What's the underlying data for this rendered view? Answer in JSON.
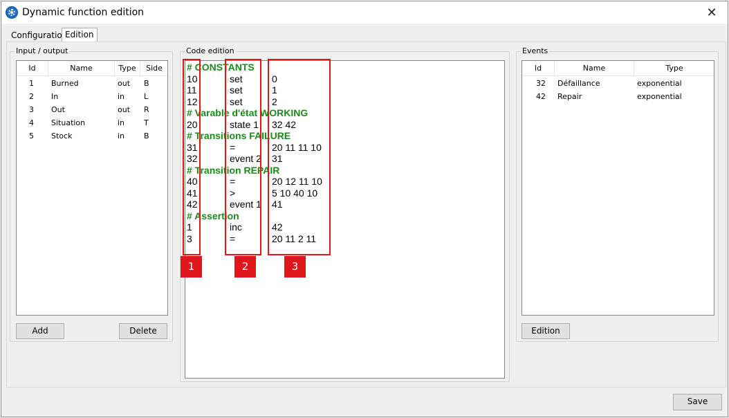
{
  "window": {
    "title": "Dynamic function edition"
  },
  "tabs": [
    {
      "label": "Configuration",
      "selected": false
    },
    {
      "label": "Edition",
      "selected": true
    }
  ],
  "io_panel": {
    "title": "Input / output",
    "columns": [
      "Id",
      "Name",
      "Type",
      "Side"
    ],
    "rows": [
      {
        "id": "1",
        "name": "Burned",
        "type": "out",
        "side": "B"
      },
      {
        "id": "2",
        "name": "In",
        "type": "in",
        "side": "L"
      },
      {
        "id": "3",
        "name": "Out",
        "type": "out",
        "side": "R"
      },
      {
        "id": "4",
        "name": "Situation",
        "type": "in",
        "side": "T"
      },
      {
        "id": "5",
        "name": "Stock",
        "type": "in",
        "side": "B"
      }
    ],
    "add_label": "Add",
    "delete_label": "Delete"
  },
  "code_panel": {
    "title": "Code edition",
    "lines": [
      {
        "kind": "comment",
        "text": "# CONSTANTS"
      },
      {
        "kind": "code",
        "c1": "10",
        "c2": "set",
        "c3": "0"
      },
      {
        "kind": "code",
        "c1": "11",
        "c2": "set",
        "c3": "1"
      },
      {
        "kind": "code",
        "c1": "12",
        "c2": "set",
        "c3": "2"
      },
      {
        "kind": "comment",
        "text": "# Varable d'état WORKING"
      },
      {
        "kind": "code",
        "c1": "20",
        "c2": "state 1",
        "c3": "32 42"
      },
      {
        "kind": "comment",
        "text": "# Transitions FAILURE"
      },
      {
        "kind": "code",
        "c1": "31",
        "c2": "=",
        "c3": "20 11 11 10"
      },
      {
        "kind": "code",
        "c1": "32",
        "c2": "event 2",
        "c3": "31"
      },
      {
        "kind": "comment",
        "text": "# Transition REPAIR"
      },
      {
        "kind": "code",
        "c1": "40",
        "c2": "=",
        "c3": "20 12 11 10"
      },
      {
        "kind": "code",
        "c1": "41",
        "c2": ">",
        "c3": "5 10 40 10"
      },
      {
        "kind": "code",
        "c1": "42",
        "c2": "event 1",
        "c3": "41"
      },
      {
        "kind": "comment",
        "text": "# Assertion"
      },
      {
        "kind": "code",
        "c1": "1",
        "c2": "inc",
        "c3": "42"
      },
      {
        "kind": "code",
        "c1": "3",
        "c2": "=",
        "c3": "20 11 2 11"
      }
    ],
    "annotation_color": "#e0161c",
    "annotations": [
      "1",
      "2",
      "3"
    ]
  },
  "events_panel": {
    "title": "Events",
    "columns": [
      "Id",
      "Name",
      "Type"
    ],
    "rows": [
      {
        "id": "32",
        "name": "Défaillance",
        "type": "exponential"
      },
      {
        "id": "42",
        "name": "Repair",
        "type": "exponential"
      }
    ],
    "edition_label": "Edition"
  },
  "footer": {
    "save_label": "Save"
  },
  "colors": {
    "comment": "#1b8a1b",
    "accent": "#1f6fc2",
    "annotation": "#e0161c"
  }
}
